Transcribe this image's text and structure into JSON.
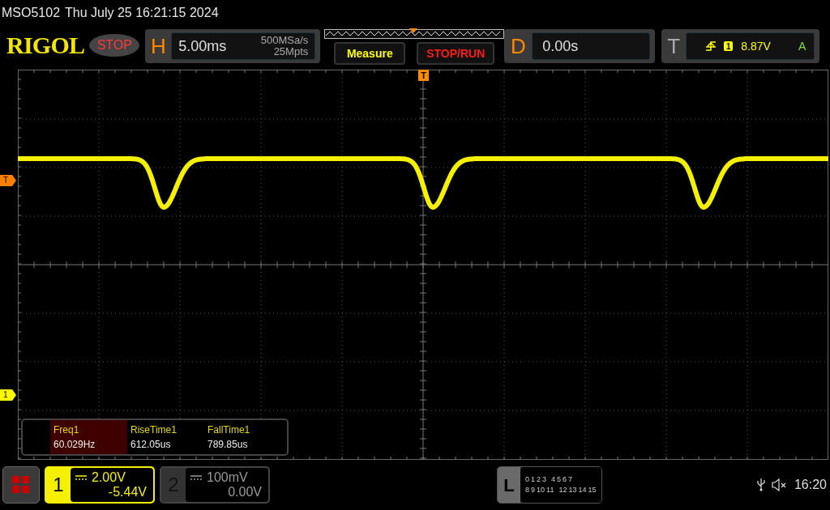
{
  "status_line": {
    "model": "MSO5102",
    "datetime": "Thu July 25 16:21:15 2024"
  },
  "toolbar": {
    "logo": "RIGOL",
    "run_state": {
      "label": "STOP",
      "kind": "stopped"
    },
    "horizontal": {
      "letter": "H",
      "timebase": "5.00ms",
      "sample_rate": "500MSa/s",
      "memory_depth": "25Mpts"
    },
    "memory_view": {
      "level": 0.5
    },
    "buttons": [
      {
        "label": "Measure",
        "kind": "measure"
      },
      {
        "label": "STOP/RUN",
        "kind": "run"
      }
    ],
    "delay": {
      "letter": "D",
      "value": "0.00s"
    },
    "trigger": {
      "letter": "T",
      "channel": "1",
      "voltage": "8.87V",
      "mode": "A"
    }
  },
  "screen": {
    "top_marker": "T",
    "markers": [
      {
        "label": "T",
        "kind": "trigger"
      },
      {
        "label": "1",
        "kind": "channel"
      }
    ],
    "measurements": [
      {
        "name": "Freq1",
        "value": "60.029Hz",
        "selected": true
      },
      {
        "name": "RiseTime1",
        "value": "612.05us",
        "selected": false
      },
      {
        "name": "FallTime1",
        "value": "789.85us",
        "selected": false
      }
    ]
  },
  "bottom_bar": {
    "channels": [
      {
        "number": "1",
        "scale": "2.00V",
        "offset": "-5.44V",
        "selected": true
      },
      {
        "number": "2",
        "scale": "100mV",
        "offset": "0.00V",
        "selected": false
      }
    ],
    "logic": {
      "letter": "L",
      "row_1": [
        "0",
        "1",
        "2",
        "3",
        "4",
        "5",
        "6",
        "7"
      ],
      "row_2": [
        "8",
        "9",
        "10",
        "11",
        "12",
        "13",
        "14",
        "15"
      ]
    },
    "clock": "16:20"
  }
}
